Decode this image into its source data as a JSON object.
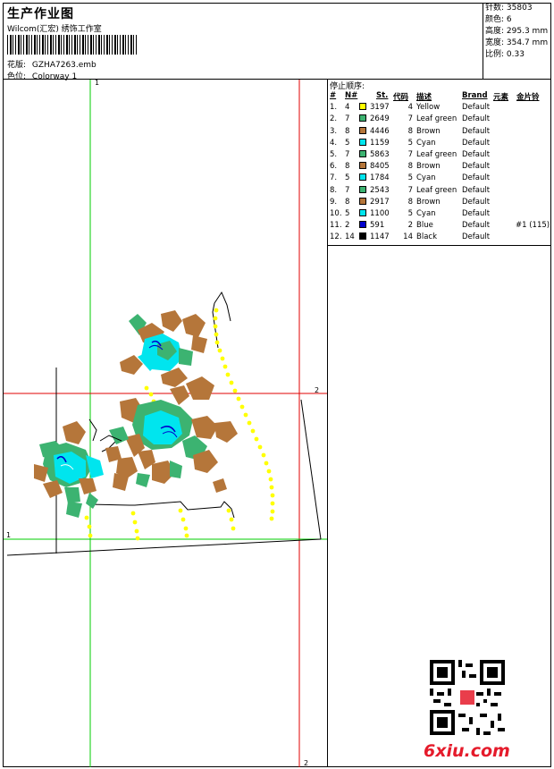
{
  "header": {
    "title": "生产作业图",
    "company": "Wilcom(汇宏) 绣饰工作室",
    "design_label": "花版:",
    "design_value": "GZHA7263.emb",
    "color_label": "色位:",
    "color_value": "Colorway 1"
  },
  "stats": [
    {
      "label": "针数:",
      "value": "35803"
    },
    {
      "label": "颜色:",
      "value": "6"
    },
    {
      "label": "高度:",
      "value": "295.3 mm"
    },
    {
      "label": "宽度:",
      "value": "354.7 mm"
    },
    {
      "label": "比例:",
      "value": "0.33"
    }
  ],
  "stop_table": {
    "title": "停止顺序:",
    "headers": {
      "num": "#",
      "needle": "N#",
      "st": "St.",
      "code": "代码",
      "desc": "描述",
      "brand": "Brand",
      "element": "元素",
      "sequin": "金片铃"
    },
    "rows": [
      {
        "num": "1.",
        "needle": "4",
        "color": "#ffff00",
        "st": "3197",
        "code": "4",
        "desc": "Yellow",
        "brand": "Default",
        "extra": ""
      },
      {
        "num": "2.",
        "needle": "7",
        "color": "#3cb371",
        "st": "2649",
        "code": "7",
        "desc": "Leaf green",
        "brand": "Default",
        "extra": ""
      },
      {
        "num": "3.",
        "needle": "8",
        "color": "#b5763a",
        "st": "4446",
        "code": "8",
        "desc": "Brown",
        "brand": "Default",
        "extra": ""
      },
      {
        "num": "4.",
        "needle": "5",
        "color": "#00e5ee",
        "st": "1159",
        "code": "5",
        "desc": "Cyan",
        "brand": "Default",
        "extra": ""
      },
      {
        "num": "5.",
        "needle": "7",
        "color": "#3cb371",
        "st": "5863",
        "code": "7",
        "desc": "Leaf green",
        "brand": "Default",
        "extra": ""
      },
      {
        "num": "6.",
        "needle": "8",
        "color": "#b5763a",
        "st": "8405",
        "code": "8",
        "desc": "Brown",
        "brand": "Default",
        "extra": ""
      },
      {
        "num": "7.",
        "needle": "5",
        "color": "#00e5ee",
        "st": "1784",
        "code": "5",
        "desc": "Cyan",
        "brand": "Default",
        "extra": ""
      },
      {
        "num": "8.",
        "needle": "7",
        "color": "#3cb371",
        "st": "2543",
        "code": "7",
        "desc": "Leaf green",
        "brand": "Default",
        "extra": ""
      },
      {
        "num": "9.",
        "needle": "8",
        "color": "#b5763a",
        "st": "2917",
        "code": "8",
        "desc": "Brown",
        "brand": "Default",
        "extra": ""
      },
      {
        "num": "10.",
        "needle": "5",
        "color": "#00e5ee",
        "st": "1100",
        "code": "5",
        "desc": "Cyan",
        "brand": "Default",
        "extra": ""
      },
      {
        "num": "11.",
        "needle": "2",
        "color": "#0000cd",
        "st": "591",
        "code": "2",
        "desc": "Blue",
        "brand": "Default",
        "extra": "#1 (115)"
      },
      {
        "num": "12.",
        "needle": "14",
        "color": "#000000",
        "st": "1147",
        "code": "14",
        "desc": "Black",
        "brand": "Default",
        "extra": ""
      }
    ]
  },
  "guides": {
    "v1": "1",
    "v2": "2",
    "h1": "1",
    "h2": "2"
  },
  "watermark": "6xiu.com",
  "colors": {
    "guide_green": "#00cc00",
    "guide_red": "#e00000",
    "yellow": "#ffff00",
    "leaf_green": "#3cb371",
    "brown": "#b5763a",
    "cyan": "#00e5ee",
    "blue": "#0000cd",
    "watermark_red": "#e51b2b"
  }
}
